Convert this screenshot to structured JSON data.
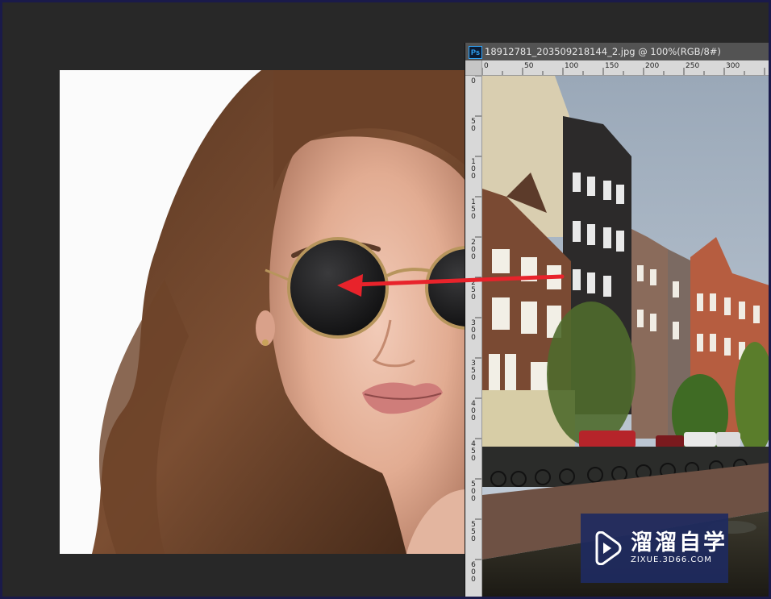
{
  "document_window": {
    "app_badge": "Ps",
    "title": "18912781_203509218144_2.jpg @ 100%(RGB/8#)"
  },
  "ruler": {
    "top_labels": [
      "0",
      "50",
      "100",
      "150",
      "200",
      "250",
      "300"
    ],
    "left_labels": [
      "0",
      "5\n0",
      "1\n0\n0",
      "1\n5\n0",
      "2\n0\n0",
      "2\n5\n0",
      "3\n0\n0",
      "3\n5\n0",
      "4\n0\n0",
      "4\n5\n0",
      "5\n0\n0",
      "5\n5\n0",
      "6\n0\n0"
    ]
  },
  "watermark": {
    "name": "溜溜自学",
    "url": "ZIXUE.3D66.COM"
  },
  "annotation": {
    "arrow_color": "#e8232b"
  }
}
